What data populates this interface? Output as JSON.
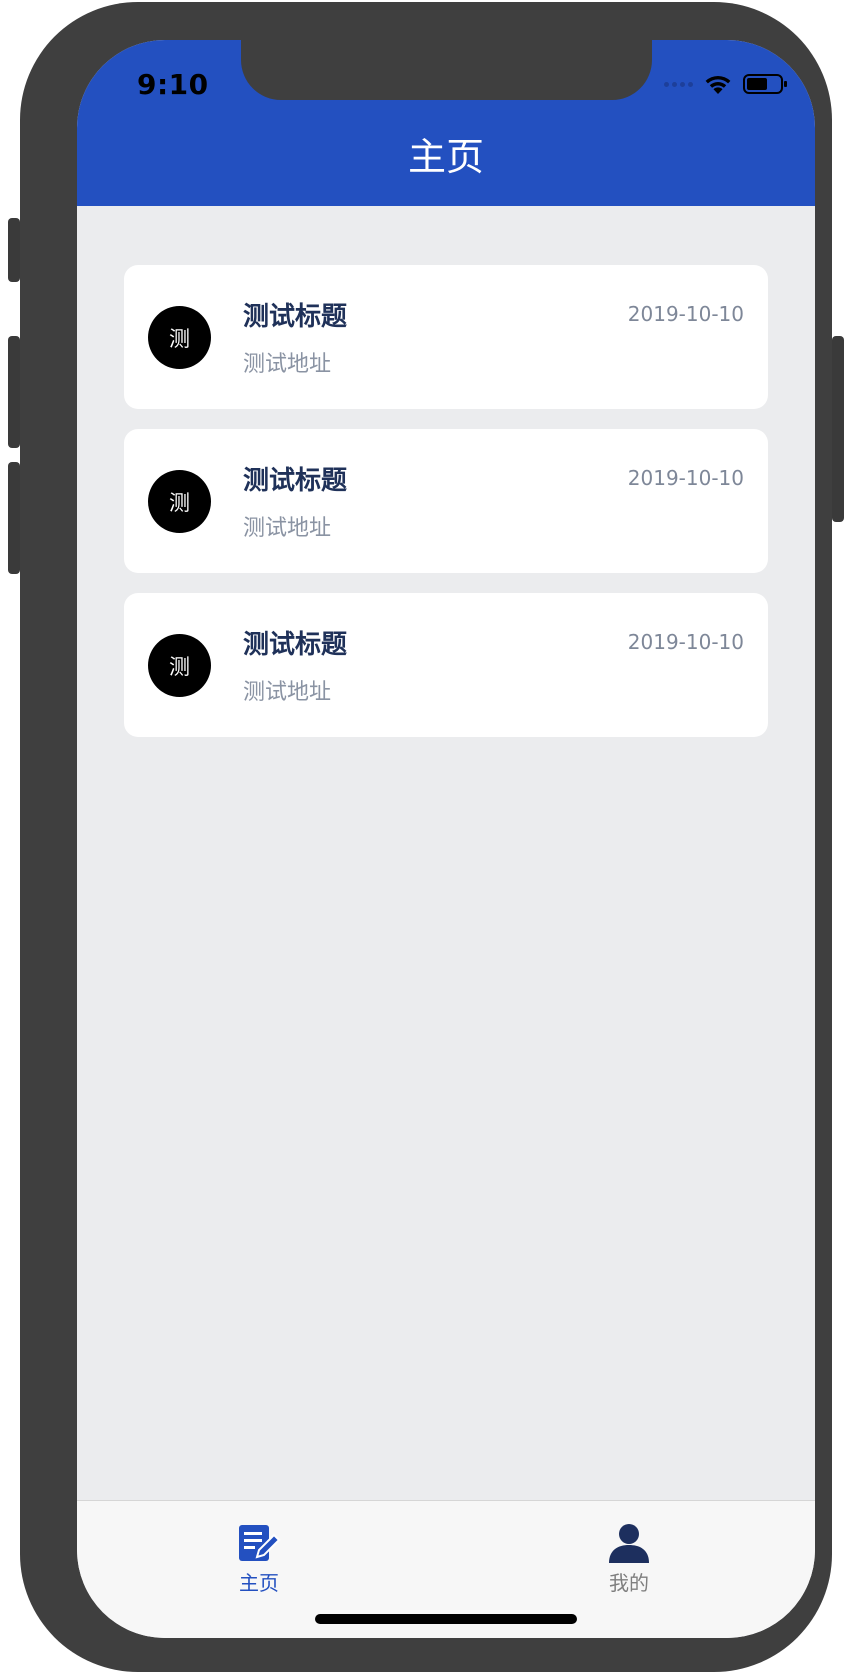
{
  "status_bar": {
    "time": "9:10",
    "wifi_icon": "wifi-icon",
    "battery_icon": "battery-icon"
  },
  "header": {
    "title": "主页"
  },
  "list": {
    "items": [
      {
        "avatar_text": "测",
        "title": "测试标题",
        "date": "2019-10-10",
        "subtitle": "测试地址"
      },
      {
        "avatar_text": "测",
        "title": "测试标题",
        "date": "2019-10-10",
        "subtitle": "测试地址"
      },
      {
        "avatar_text": "测",
        "title": "测试标题",
        "date": "2019-10-10",
        "subtitle": "测试地址"
      }
    ]
  },
  "tabbar": {
    "home": {
      "label": "主页",
      "icon": "edit-note-icon",
      "active": true
    },
    "mine": {
      "label": "我的",
      "icon": "user-icon",
      "active": false
    }
  },
  "colors": {
    "primary": "#2350c0",
    "background": "#ebecee",
    "card": "#ffffff",
    "title_text": "#1f3159",
    "secondary_text": "#8a93a3",
    "tab_inactive": "#7f7f7f"
  }
}
